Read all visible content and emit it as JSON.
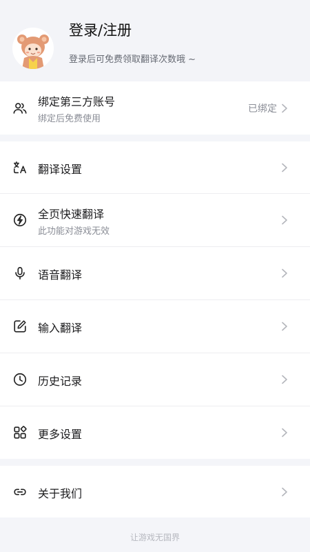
{
  "header": {
    "title": "登录/注册",
    "subtitle": "登录后可免费领取翻译次数哦 ~"
  },
  "account": {
    "label": "绑定第三方账号",
    "sub": "绑定后免费使用",
    "status": "已绑定"
  },
  "menu": [
    {
      "label": "翻译设置",
      "sub": "",
      "icon": "translate-icon"
    },
    {
      "label": "全页快速翻译",
      "sub": "此功能对游戏无效",
      "icon": "fast-translate-icon"
    },
    {
      "label": "语音翻译",
      "sub": "",
      "icon": "microphone-icon"
    },
    {
      "label": "输入翻译",
      "sub": "",
      "icon": "edit-icon"
    },
    {
      "label": "历史记录",
      "sub": "",
      "icon": "clock-icon"
    },
    {
      "label": "更多设置",
      "sub": "",
      "icon": "grid-icon"
    }
  ],
  "about": {
    "label": "关于我们",
    "icon": "link-icon"
  },
  "footer": {
    "slogan": "让游戏无国界"
  },
  "colors": {
    "background": "#f4f5f9",
    "card": "#ffffff",
    "text": "#1d1d1f",
    "muted": "#8a8d96",
    "avatar_accent": "#e8a07a"
  }
}
